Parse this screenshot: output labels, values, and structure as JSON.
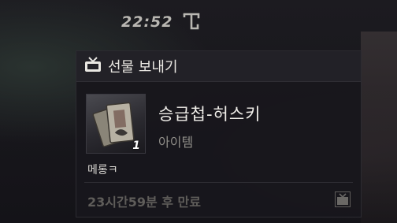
{
  "clock": {
    "time": "22:52"
  },
  "panel": {
    "title": "선물 보내기",
    "item": {
      "name": "승급첩-허스키",
      "type": "아이템",
      "count": "1"
    },
    "sender": "메롱ㅋ",
    "expiry": "23시간59분 후 만료"
  },
  "colors": {
    "panel_bg": "#18171c",
    "header_bg": "#222127",
    "title_text": "#e9e7e2",
    "muted_text": "#8f8d88",
    "expiry_text": "#5f5d5a"
  },
  "icons": {
    "clock_badge": "t-badge-icon",
    "header": "gift-box-icon",
    "footer": "gift-box-icon"
  }
}
